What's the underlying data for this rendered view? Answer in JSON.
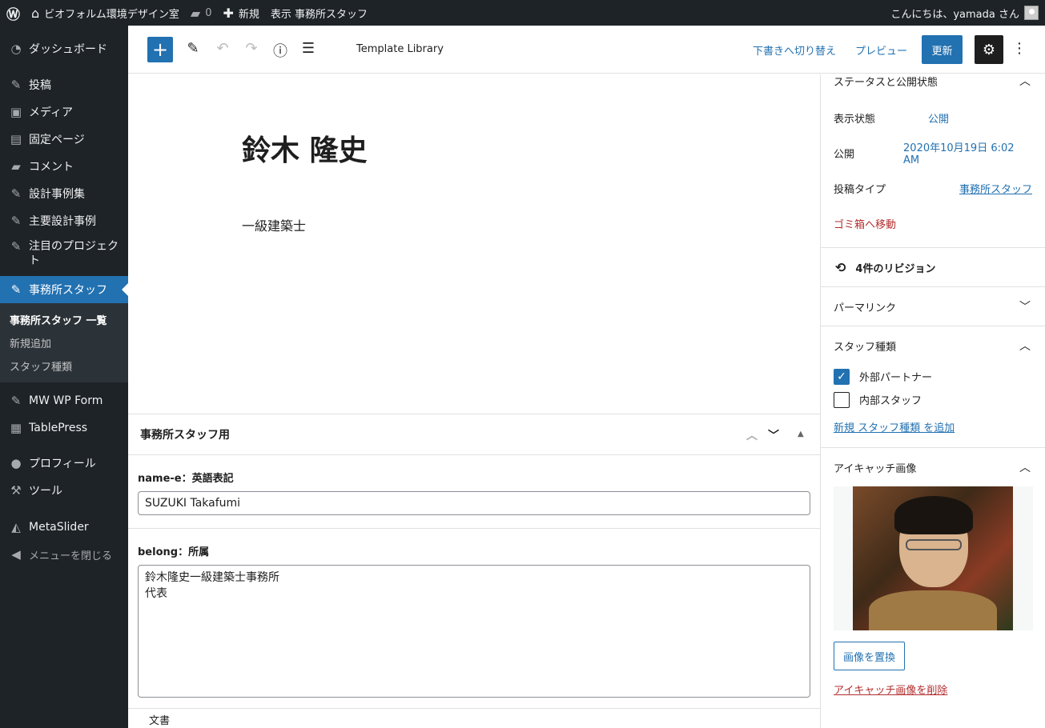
{
  "adminbar": {
    "site_name": "ビオフォルム環境デザイン室",
    "comments": "0",
    "new_label": "新規",
    "view_label": "表示 事務所スタッフ",
    "greeting": "こんにちは、yamada さん"
  },
  "sidebar": {
    "items": [
      {
        "label": "ダッシュボード",
        "icon": "gauge-icon"
      },
      {
        "label": "投稿",
        "icon": "pin-icon"
      },
      {
        "label": "メディア",
        "icon": "media-icon"
      },
      {
        "label": "固定ページ",
        "icon": "page-icon"
      },
      {
        "label": "コメント",
        "icon": "comment-icon"
      },
      {
        "label": "設計事例集",
        "icon": "pin-icon"
      },
      {
        "label": "主要設計事例",
        "icon": "pin-icon"
      },
      {
        "label": "注目のプロジェクト",
        "icon": "pin-icon"
      },
      {
        "label": "事務所スタッフ",
        "icon": "pin-icon"
      },
      {
        "label": "MW WP Form",
        "icon": "pin-icon"
      },
      {
        "label": "TablePress",
        "icon": "table-icon"
      },
      {
        "label": "プロフィール",
        "icon": "user-icon"
      },
      {
        "label": "ツール",
        "icon": "wrench-icon"
      },
      {
        "label": "MetaSlider",
        "icon": "metaslider-icon"
      },
      {
        "label": "メニューを閉じる",
        "icon": "collapse-icon"
      }
    ],
    "submenu": [
      "事務所スタッフ 一覧",
      "新規追加",
      "スタッフ種類"
    ]
  },
  "toolbar": {
    "template_library": "Template Library",
    "switch_draft": "下書きへ切り替え",
    "preview": "プレビュー",
    "update": "更新"
  },
  "post": {
    "title": "鈴木 隆史",
    "paragraph": "一級建築士"
  },
  "metabox": {
    "title": "事務所スタッフ用",
    "field1_label": "name-e：英語表記",
    "field1_value": "SUZUKI Takafumi",
    "field2_label": "belong：所属",
    "field2_value": "鈴木隆史一級建築士事務所\n代表"
  },
  "footer": {
    "breadcrumb": "文書"
  },
  "panel": {
    "status_title": "ステータスと公開状態",
    "visibility_label": "表示状態",
    "visibility_value": "公開",
    "publish_label": "公開",
    "publish_value": "2020年10月19日 6:02 AM",
    "posttype_label": "投稿タイプ",
    "posttype_value": "事務所スタッフ",
    "trash": "ゴミ箱へ移動",
    "revisions": "4件のリビジョン",
    "permalink": "パーマリンク",
    "staff_type_title": "スタッフ種類",
    "staff_types": [
      {
        "label": "外部パートナー",
        "checked": true
      },
      {
        "label": "内部スタッフ",
        "checked": false
      }
    ],
    "add_new_type": "新規 スタッフ種類 を追加",
    "featured_title": "アイキャッチ画像",
    "replace_image": "画像を置換",
    "remove_image": "アイキャッチ画像を削除"
  },
  "colors": {
    "accent": "#2271b1",
    "danger": "#b32d2e",
    "admin_bg": "#1d2327"
  }
}
